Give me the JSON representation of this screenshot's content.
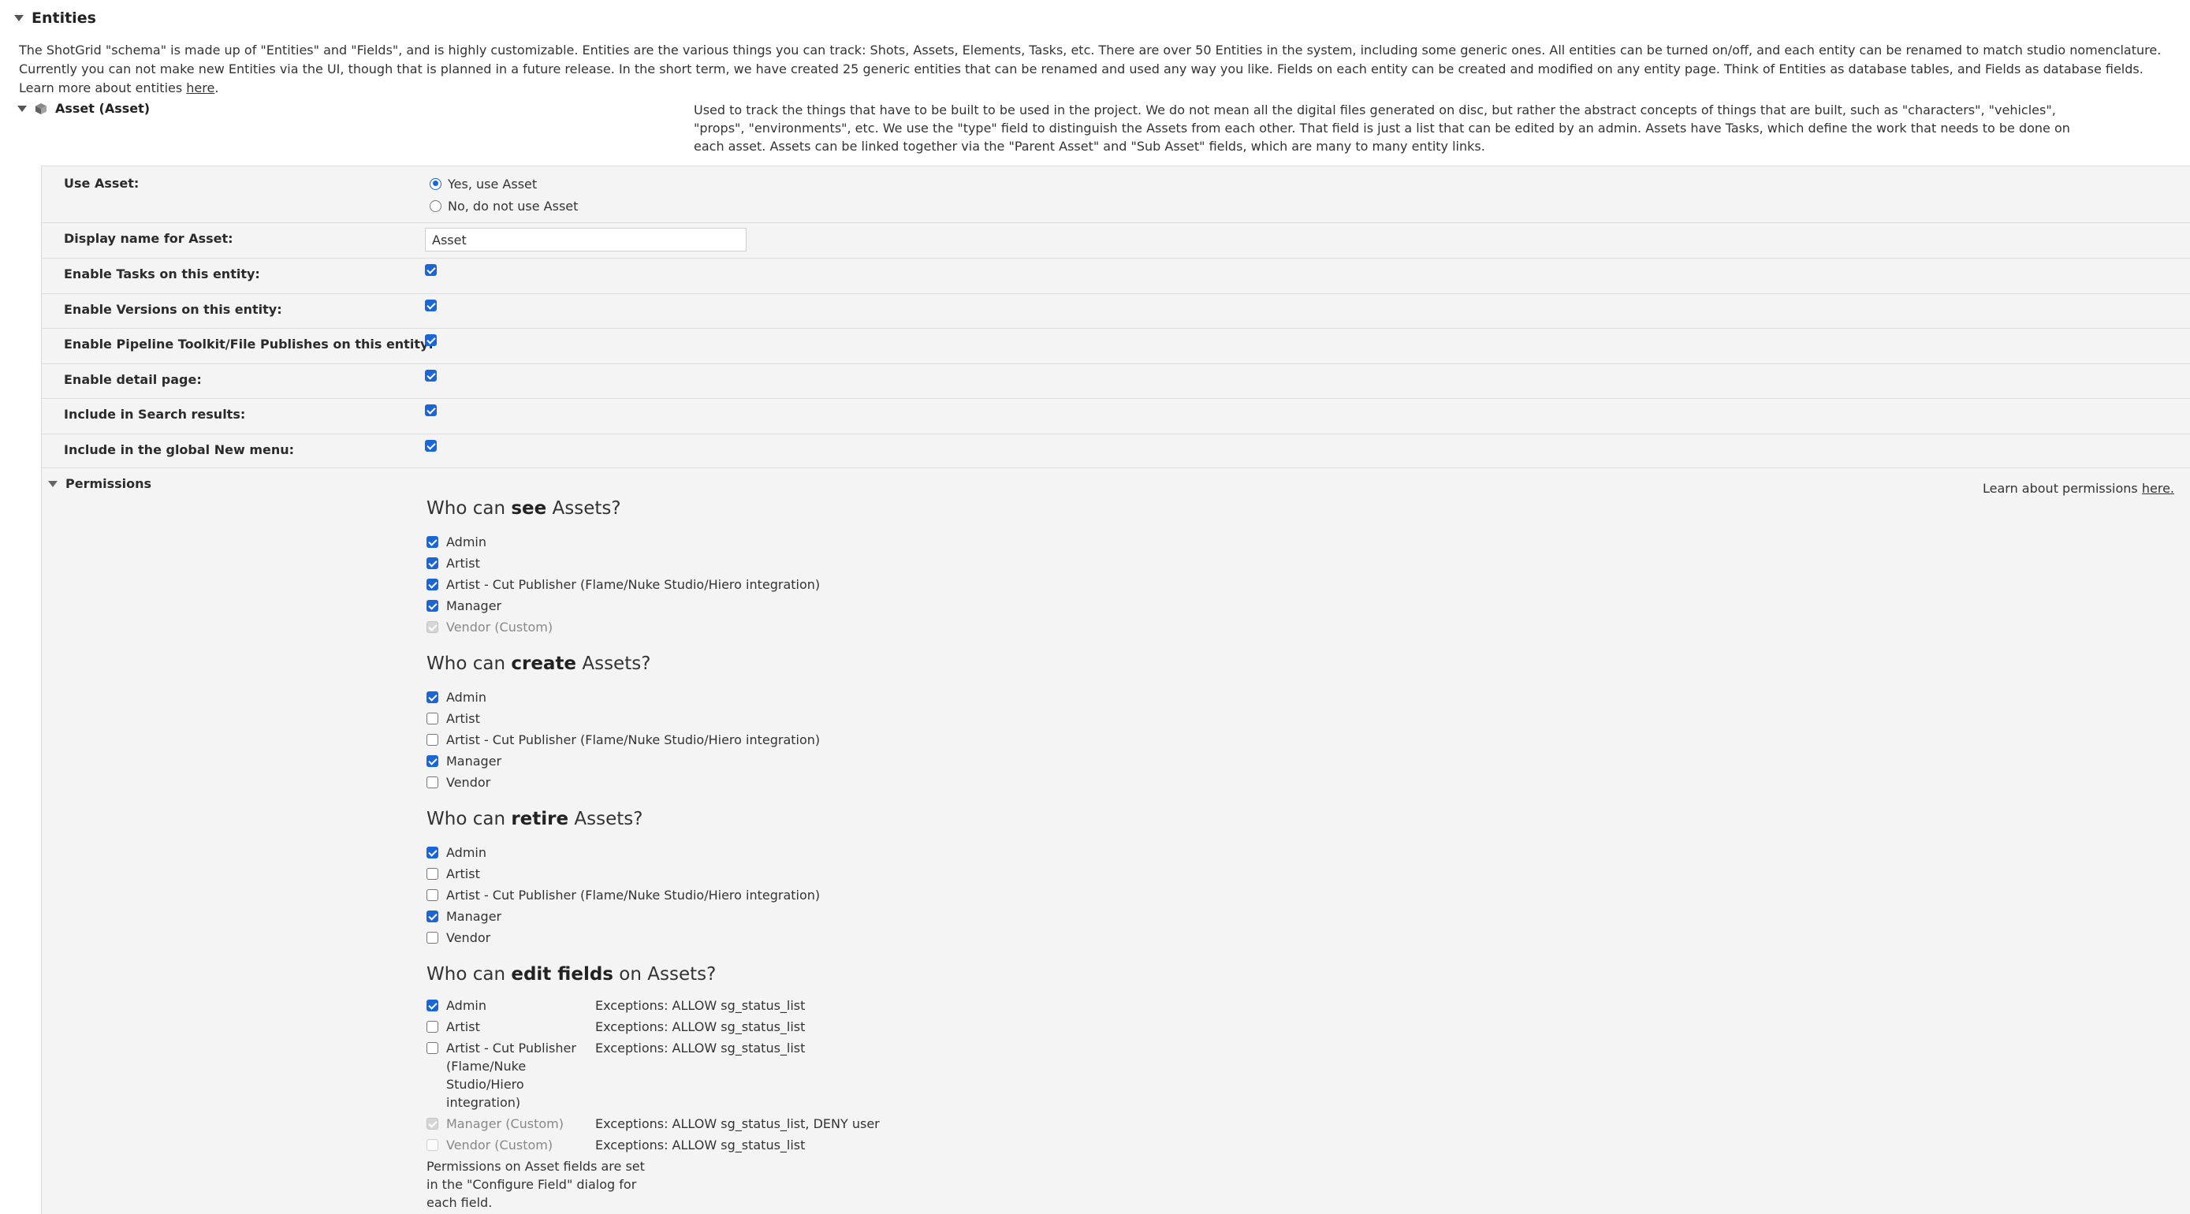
{
  "section": {
    "title": "Entities"
  },
  "intro": {
    "text": "The ShotGrid \"schema\" is made up of \"Entities\" and \"Fields\", and is highly customizable. Entities are the various things you can track: Shots, Assets, Elements, Tasks, etc. There are over 50 Entities in the system, including some generic ones. All entities can be turned on/off, and each entity can be renamed to match studio nomenclature. Currently you can not make new Entities via the UI, though that is planned in a future release. In the short term, we have created 25 generic entities that can be renamed and used any way you like. Fields on each entity can be created and modified on any entity page. Think of Entities as database tables, and Fields as database fields. Learn more about entities ",
    "link": "here",
    "tail": "."
  },
  "entity": {
    "title": "Asset (Asset)",
    "description": "Used to track the things that have to be built to be used in the project. We do not mean all the digital files generated on disc, but rather the abstract concepts of things that are built, such as \"characters\", \"vehicles\", \"props\", \"environments\", etc. We use the \"type\" field to distinguish the Assets from each other. That field is just a list that can be edited by an admin. Assets have Tasks, which define the work that needs to be done on each asset. Assets can be linked together via the \"Parent Asset\" and \"Sub Asset\" fields, which are many to many entity links."
  },
  "settings": {
    "use_label": "Use Asset:",
    "use_yes": "Yes, use Asset",
    "use_no": "No, do not use Asset",
    "display_label": "Display name for Asset:",
    "display_value": "Asset",
    "tasks_label": "Enable Tasks on this entity:",
    "versions_label": "Enable Versions on this entity:",
    "pipeline_label": "Enable Pipeline Toolkit/File Publishes on this entity:",
    "detail_label": "Enable detail page:",
    "search_label": "Include in Search results:",
    "newmenu_label": "Include in the global New menu:"
  },
  "permissions": {
    "title": "Permissions",
    "learn_prefix": "Learn about permissions ",
    "learn_link": "here.",
    "see": {
      "prefix": "Who can ",
      "verb": "see",
      "suffix": " Assets?",
      "roles": [
        "Admin",
        "Artist",
        "Artist - Cut Publisher (Flame/Nuke Studio/Hiero integration)",
        "Manager",
        "Vendor (Custom)"
      ]
    },
    "create": {
      "prefix": "Who can ",
      "verb": "create",
      "suffix": " Assets?",
      "roles": [
        "Admin",
        "Artist",
        "Artist - Cut Publisher (Flame/Nuke Studio/Hiero integration)",
        "Manager",
        "Vendor"
      ]
    },
    "retire": {
      "prefix": "Who can ",
      "verb": "retire",
      "suffix": " Assets?",
      "roles": [
        "Admin",
        "Artist",
        "Artist - Cut Publisher (Flame/Nuke Studio/Hiero integration)",
        "Manager",
        "Vendor"
      ]
    },
    "edit": {
      "prefix": "Who can ",
      "verb": "edit fields",
      "suffix": " on Assets?",
      "rows": [
        {
          "role": "Admin",
          "exceptions": "Exceptions: ALLOW sg_status_list"
        },
        {
          "role": "Artist",
          "exceptions": "Exceptions: ALLOW sg_status_list"
        },
        {
          "role": "Artist - Cut Publisher (Flame/Nuke Studio/Hiero integration)",
          "exceptions": "Exceptions: ALLOW sg_status_list"
        },
        {
          "role": "Manager (Custom)",
          "exceptions": "Exceptions: ALLOW sg_status_list, DENY user"
        },
        {
          "role": "Vendor (Custom)",
          "exceptions": "Exceptions: ALLOW sg_status_list"
        }
      ]
    },
    "note": "Permissions on Asset fields are set in the \"Configure Field\" dialog for each field."
  }
}
